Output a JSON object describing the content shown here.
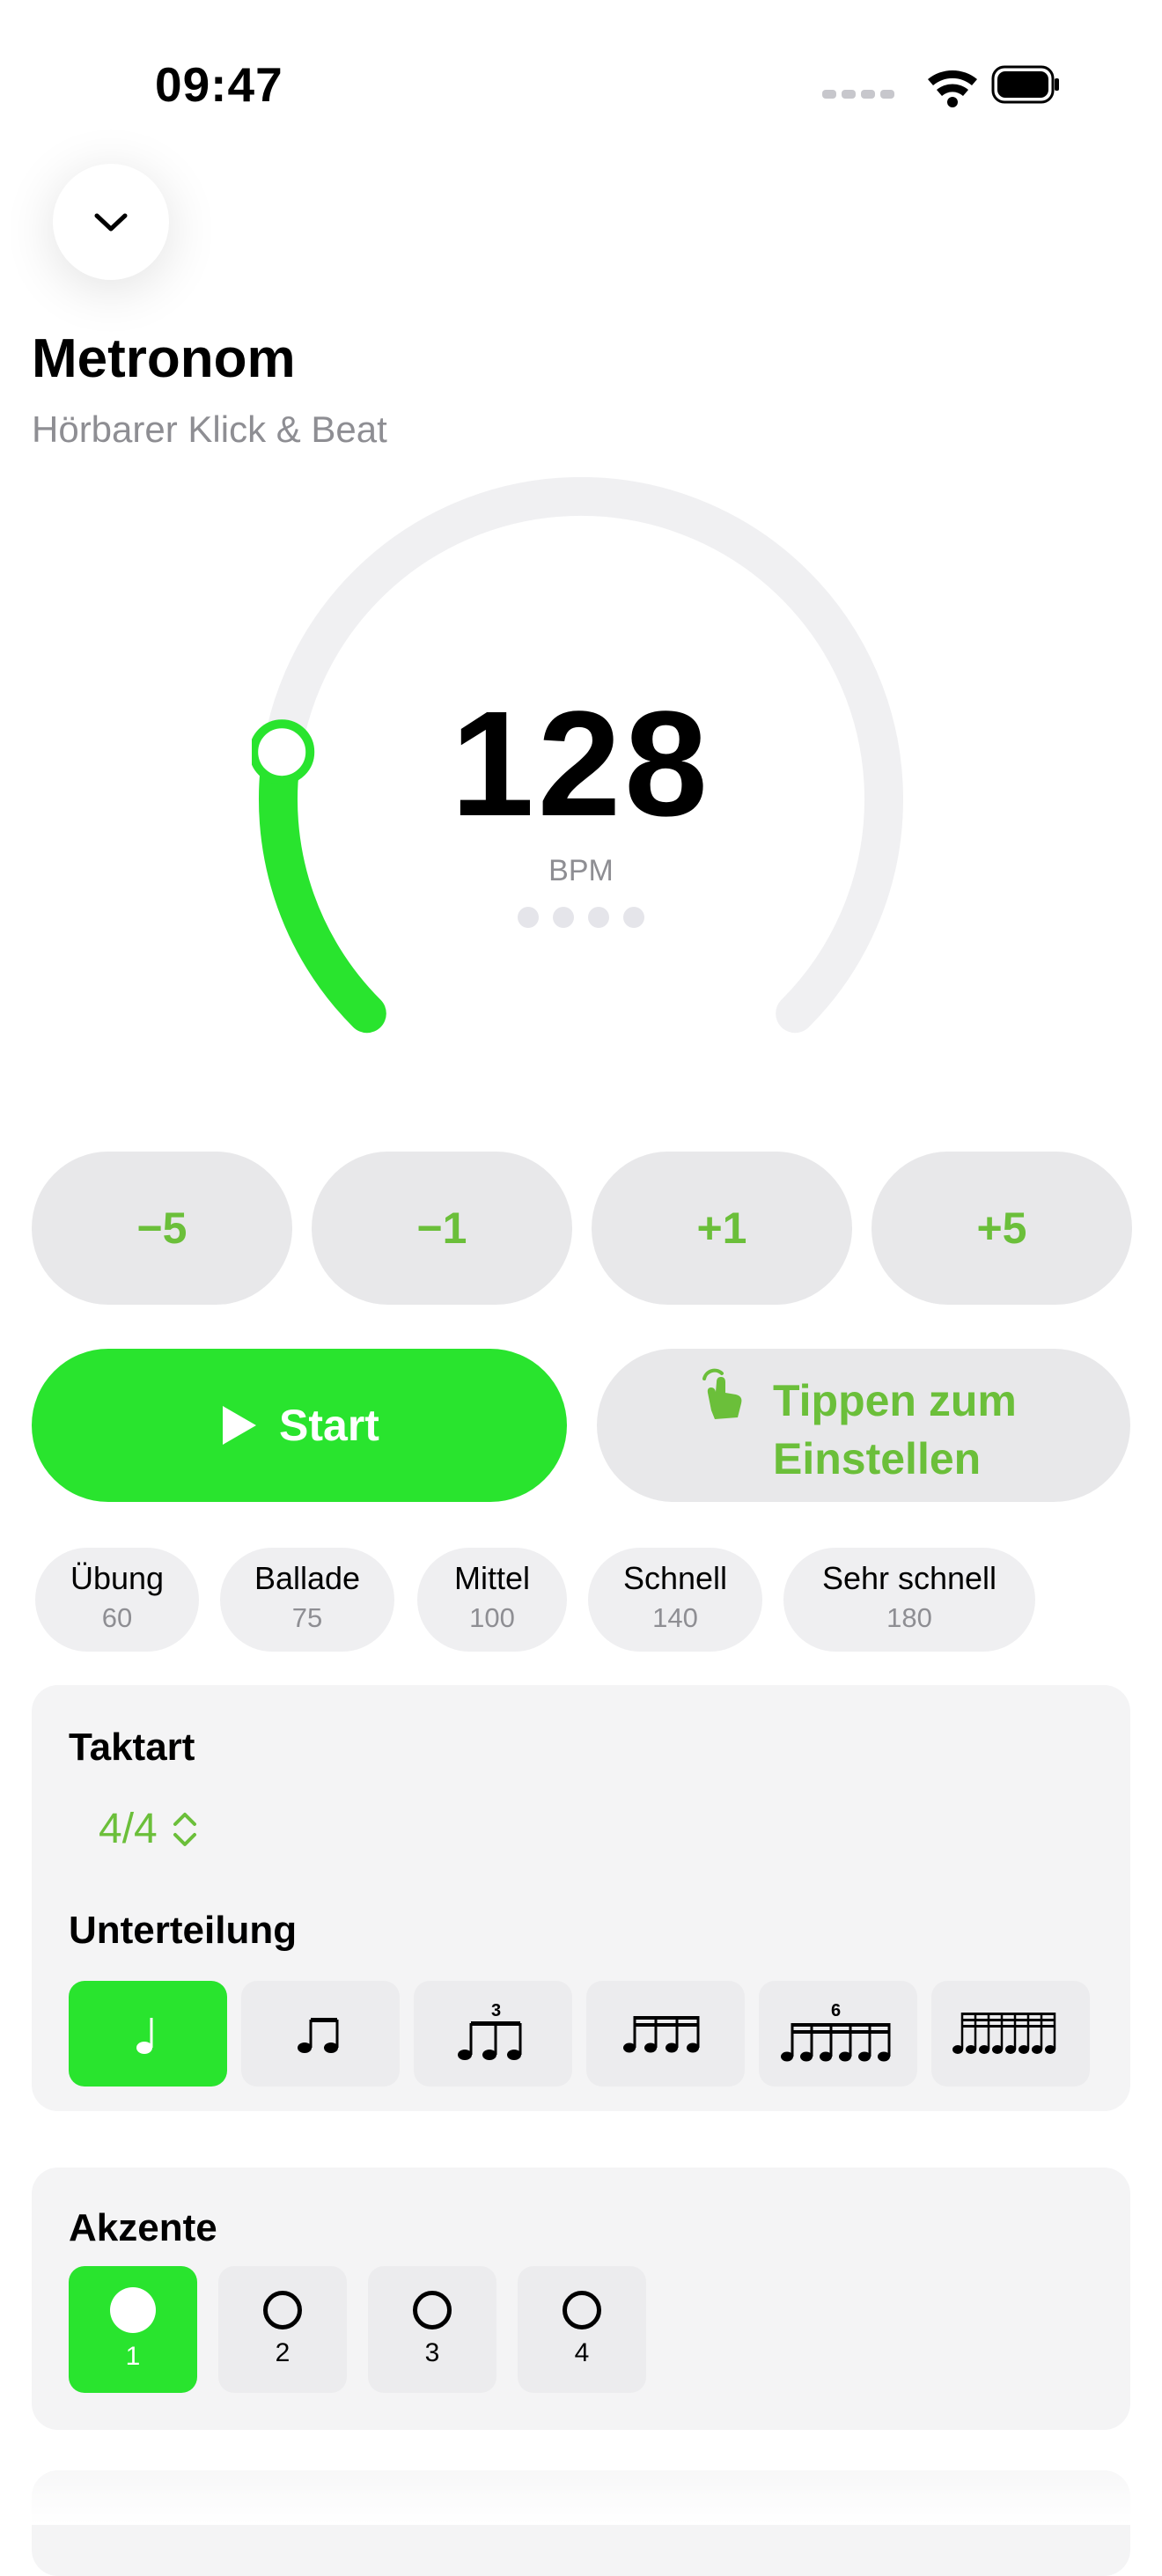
{
  "status": {
    "time": "09:47"
  },
  "header": {
    "title": "Metronom",
    "subtitle": "Hörbarer Klick & Beat"
  },
  "tempo": {
    "value": "128",
    "unit": "BPM",
    "dial_fraction": 0.2,
    "beats": 4
  },
  "steps": [
    {
      "label": "−5"
    },
    {
      "label": "−1"
    },
    {
      "label": "+1"
    },
    {
      "label": "+5"
    }
  ],
  "controls": {
    "start_label": "Start",
    "tap_line1": "Tippen zum",
    "tap_line2": "Einstellen"
  },
  "presets": [
    {
      "name": "Übung",
      "bpm": "60"
    },
    {
      "name": "Ballade",
      "bpm": "75"
    },
    {
      "name": "Mittel",
      "bpm": "100"
    },
    {
      "name": "Schnell",
      "bpm": "140"
    },
    {
      "name": "Sehr schnell",
      "bpm": "180"
    }
  ],
  "time_signature": {
    "label": "Taktart",
    "value": "4/4"
  },
  "subdivision": {
    "label": "Unterteilung",
    "options": [
      {
        "icon": "quarter-note-icon",
        "selected": true
      },
      {
        "icon": "eighth-notes-icon",
        "selected": false
      },
      {
        "icon": "triplets-icon",
        "tuplet": "3",
        "selected": false
      },
      {
        "icon": "sixteenth-notes-icon",
        "selected": false
      },
      {
        "icon": "sextuplets-icon",
        "tuplet": "6",
        "selected": false
      },
      {
        "icon": "thirty-second-notes-icon",
        "selected": false
      }
    ]
  },
  "accents": {
    "label": "Akzente",
    "items": [
      {
        "num": "1",
        "accented": true
      },
      {
        "num": "2",
        "accented": false
      },
      {
        "num": "3",
        "accented": false
      },
      {
        "num": "4",
        "accented": false
      }
    ]
  },
  "colors": {
    "accent": "#29e42e",
    "tint": "#6bbf3a",
    "track": "#f0f0f2"
  }
}
